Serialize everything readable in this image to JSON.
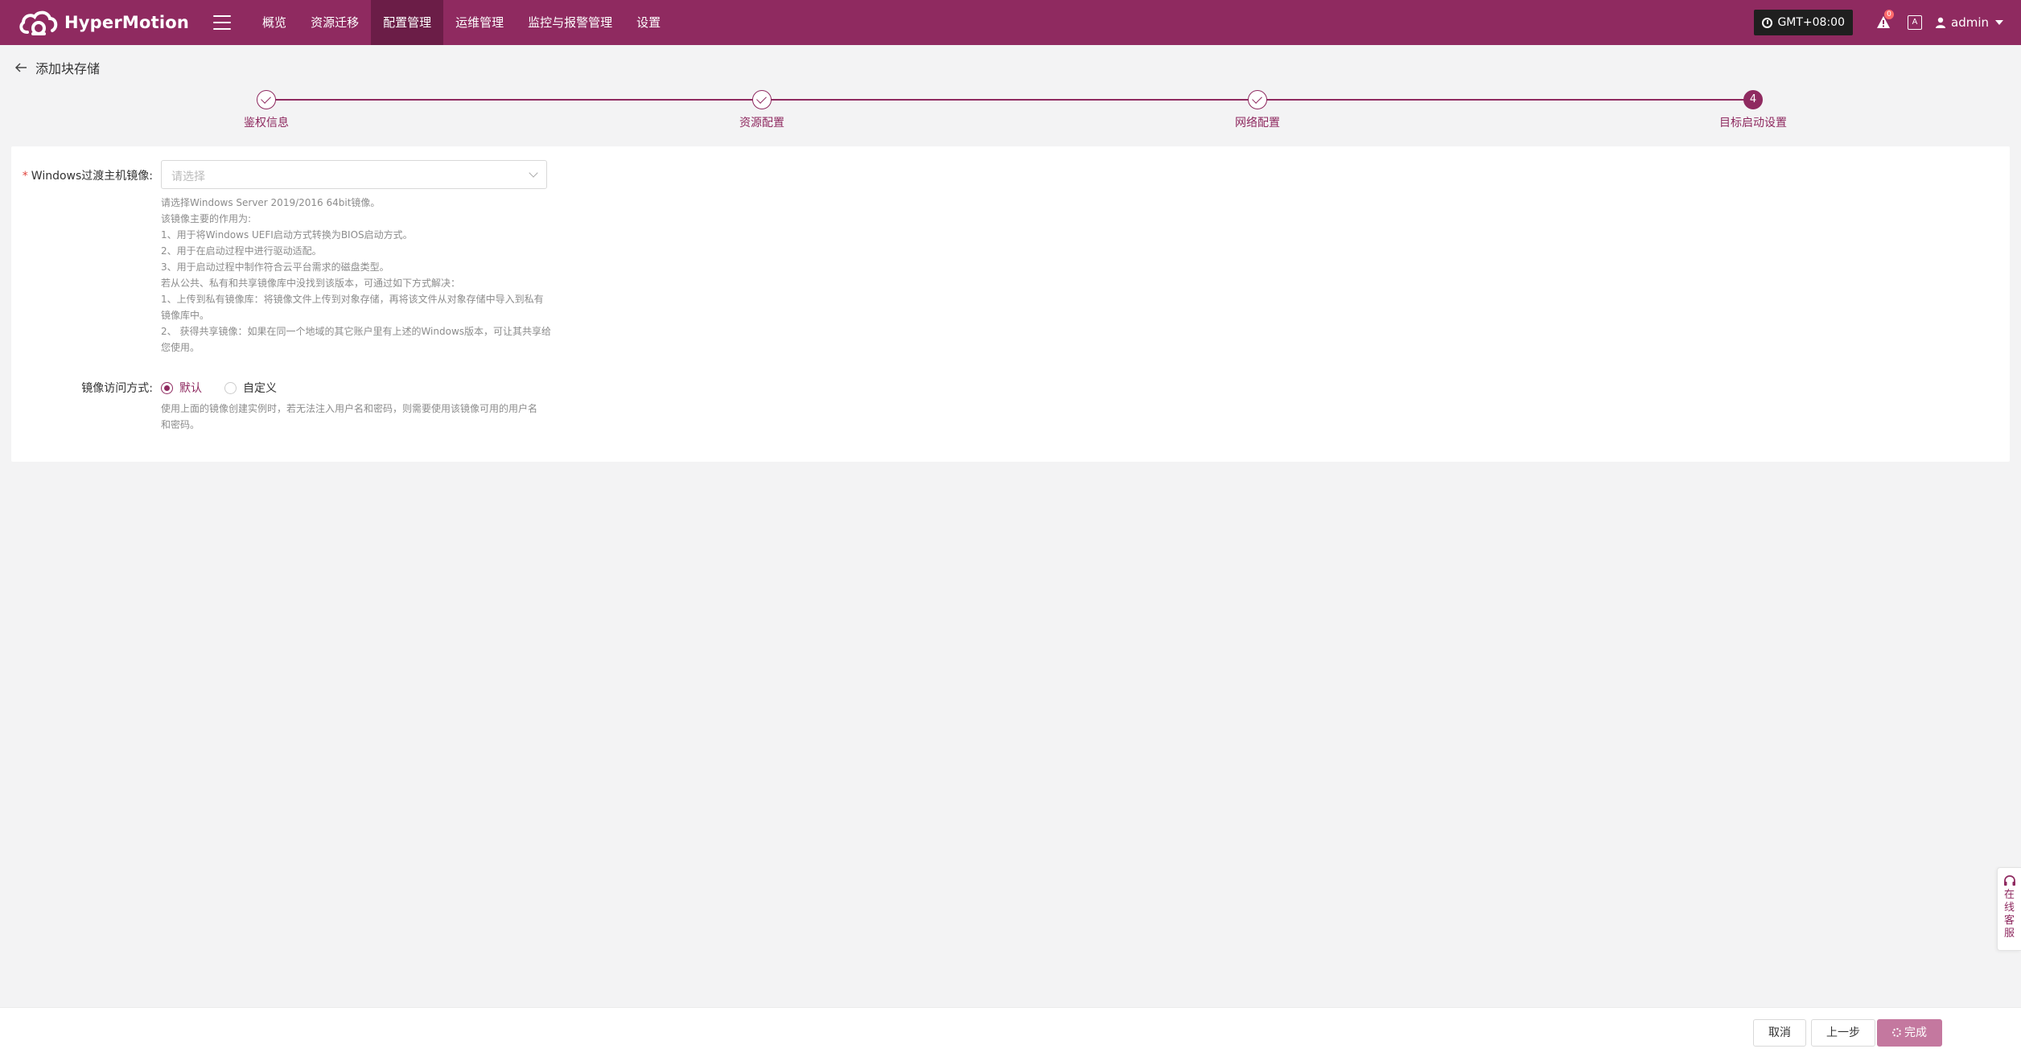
{
  "app": {
    "brand": "HyperMotion",
    "brand_color": "#8f2a60"
  },
  "nav": {
    "items": [
      {
        "label": "概览"
      },
      {
        "label": "资源迁移"
      },
      {
        "label": "配置管理",
        "active": true
      },
      {
        "label": "运维管理"
      },
      {
        "label": "监控与报警管理"
      },
      {
        "label": "设置"
      }
    ]
  },
  "header_right": {
    "timezone": "GMT+08:00",
    "notification_count": "0",
    "lang_label": "A",
    "user": "admin"
  },
  "page": {
    "title": "添加块存储"
  },
  "steps": [
    {
      "label": "鉴权信息",
      "status": "done"
    },
    {
      "label": "资源配置",
      "status": "done"
    },
    {
      "label": "网络配置",
      "status": "done"
    },
    {
      "label": "目标启动设置",
      "status": "current",
      "number": "4"
    }
  ],
  "form": {
    "windows_image": {
      "label": "Windows过渡主机镜像:",
      "required": true,
      "placeholder": "请选择",
      "help_lines": [
        "请选择Windows Server 2019/2016 64bit镜像。",
        "该镜像主要的作用为:",
        "1、用于将Windows UEFI启动方式转换为BIOS启动方式。",
        "2、用于在启动过程中进行驱动适配。",
        "3、用于启动过程中制作符合云平台需求的磁盘类型。",
        "若从公共、私有和共享镜像库中没找到该版本，可通过如下方式解决：",
        "1、上传到私有镜像库：将镜像文件上传到对象存储，再将该文件从对象存储中导入到私有",
        "镜像库中。",
        "2、 获得共享镜像：如果在同一个地域的其它账户里有上述的Windows版本，可让其共享给",
        "您使用。"
      ]
    },
    "access_mode": {
      "label": "镜像访问方式:",
      "options": [
        {
          "label": "默认",
          "checked": true
        },
        {
          "label": "自定义",
          "checked": false
        }
      ],
      "help_lines": [
        "使用上面的镜像创建实例时，若无法注入用户名和密码，则需要使用该镜像可用的用户名",
        "和密码。"
      ]
    }
  },
  "side_service": {
    "text": "在线客服"
  },
  "footer": {
    "cancel": "取消",
    "prev": "上一步",
    "finish": "完成"
  }
}
